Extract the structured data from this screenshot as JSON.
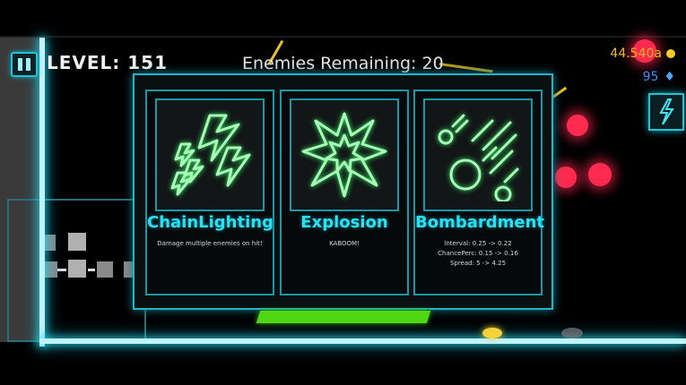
{
  "hud": {
    "level_label": "LEVEL: 151",
    "enemies_remaining": "Enemies Remaining: 20",
    "gold": "44.540a",
    "gems": "95"
  },
  "upgrades": [
    {
      "title": "ChainLighting",
      "description": "Damage multiple enemies on hit!",
      "stats": [],
      "icon": "chain-lightning-icon"
    },
    {
      "title": "Explosion",
      "description": "KABOOM!",
      "stats": [],
      "icon": "explosion-icon"
    },
    {
      "title": "Bombardment",
      "description": "",
      "stats": [
        "Interval: 0.25 -> 0.22",
        "ChancePerc: 0.15 -> 0.16",
        "Spread: 5 -> 4.25"
      ],
      "icon": "bombardment-icon"
    }
  ],
  "colors": {
    "neon_cyan": "#28e1f4",
    "enemy_red": "#ff2a4f",
    "gold": "#f2b51c",
    "gem_blue": "#3d8cff",
    "progress_green": "#4fd714"
  }
}
